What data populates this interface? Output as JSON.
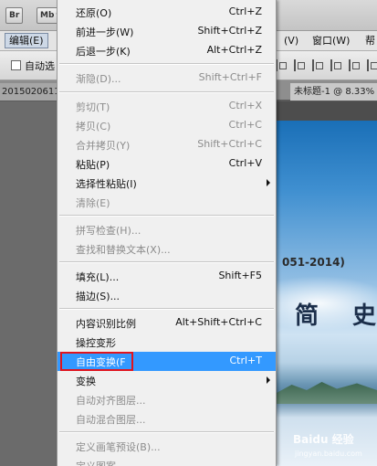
{
  "topbar": {
    "br_button": "Br",
    "mb_button": "Mb"
  },
  "menubar": {
    "edit_menu": "编辑(E)",
    "view_menu": "(V)",
    "window_menu": "窗口(W)",
    "help_menu": "帮"
  },
  "options_bar": {
    "auto_select_label": "自动选"
  },
  "tabs": {
    "left_tab": "2015020611",
    "right_tab": "未标题-1 @ 8.33%"
  },
  "canvas": {
    "years_text": "051-2014)",
    "title_chars": "简 史",
    "watermark": "Baidu 经验",
    "watermark_url": "jingyan.baidu.com"
  },
  "menu": {
    "undo": {
      "label": "还原(O)",
      "shortcut": "Ctrl+Z"
    },
    "step_forward": {
      "label": "前进一步(W)",
      "shortcut": "Shift+Ctrl+Z"
    },
    "step_backward": {
      "label": "后退一步(K)",
      "shortcut": "Alt+Ctrl+Z"
    },
    "fade": {
      "label": "渐隐(D)...",
      "shortcut": "Shift+Ctrl+F"
    },
    "cut": {
      "label": "剪切(T)",
      "shortcut": "Ctrl+X"
    },
    "copy": {
      "label": "拷贝(C)",
      "shortcut": "Ctrl+C"
    },
    "copy_merged": {
      "label": "合并拷贝(Y)",
      "shortcut": "Shift+Ctrl+C"
    },
    "paste": {
      "label": "粘贴(P)",
      "shortcut": "Ctrl+V"
    },
    "paste_special": {
      "label": "选择性粘贴(I)"
    },
    "clear": {
      "label": "清除(E)"
    },
    "check_spelling": {
      "label": "拼写检查(H)..."
    },
    "find_replace": {
      "label": "查找和替换文本(X)..."
    },
    "fill": {
      "label": "填充(L)...",
      "shortcut": "Shift+F5"
    },
    "stroke": {
      "label": "描边(S)..."
    },
    "content_aware_scale": {
      "label": "内容识别比例",
      "shortcut": "Alt+Shift+Ctrl+C"
    },
    "puppet_warp": {
      "label": "操控变形"
    },
    "free_transform": {
      "label": "自由变换(F",
      "shortcut": "Ctrl+T"
    },
    "transform": {
      "label": "变换"
    },
    "auto_align_layers": {
      "label": "自动对齐图层..."
    },
    "auto_blend_layers": {
      "label": "自动混合图层..."
    },
    "define_brush": {
      "label": "定义画笔预设(B)..."
    },
    "define_pattern": {
      "label": "定义图案..."
    }
  }
}
